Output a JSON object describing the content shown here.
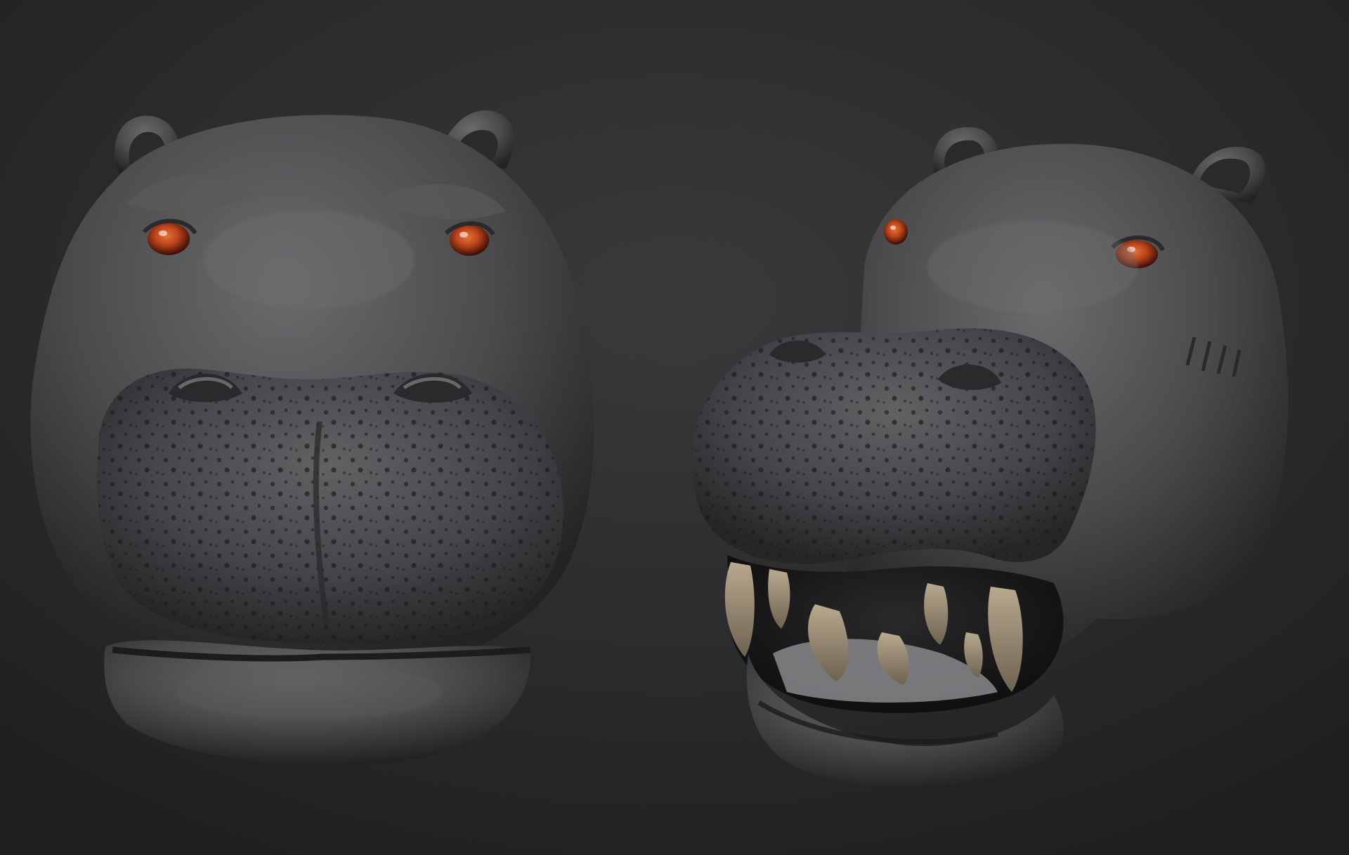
{
  "scene": {
    "subjects": [
      {
        "id": "hippo-front",
        "pose": "front",
        "mouth": "closed"
      },
      {
        "id": "hippo-three-quarter",
        "pose": "three-quarter",
        "mouth": "open"
      }
    ]
  },
  "colors": {
    "background_center": "#3a3a3c",
    "background_edge": "#1f1f21",
    "skin_light": "#6b6b6e",
    "skin_mid": "#4a4a4d",
    "skin_dark": "#232325",
    "eye_iris": "#c0461c",
    "eye_dark": "#3a0c04",
    "tooth_light": "#b8a98f",
    "tooth_dark": "#6e6250",
    "mouth_inner": "#8a8a8d"
  }
}
